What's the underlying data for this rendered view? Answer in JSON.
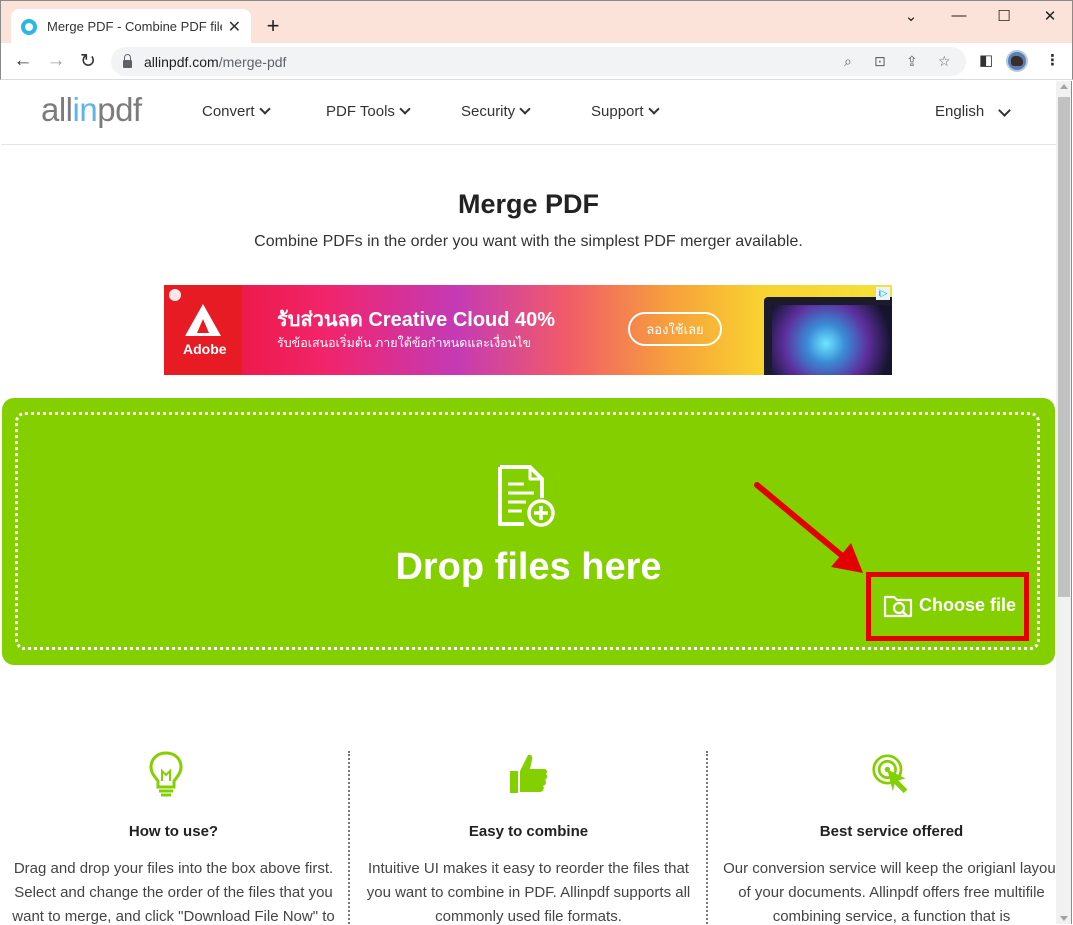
{
  "browser": {
    "tab_title": "Merge PDF - Combine PDF files",
    "tab_close": "✕",
    "new_tab": "+",
    "url_host": "allinpdf.com",
    "url_path": "/merge-pdf"
  },
  "site": {
    "logo_prefix": "all",
    "logo_in": "in",
    "logo_suffix": "pdf",
    "nav": [
      {
        "label": "Convert"
      },
      {
        "label": "PDF Tools"
      },
      {
        "label": "Security"
      },
      {
        "label": "Support"
      }
    ],
    "language": "English"
  },
  "hero": {
    "title": "Merge PDF",
    "subtitle": "Combine PDFs in the order you want with the simplest PDF merger available."
  },
  "ad": {
    "brand": "Adobe",
    "headline": "รับส่วนลด Creative Cloud 40%",
    "subline": "รับข้อเสนอเริ่มต้น ภายใต้ข้อกำหนดและเงื่อนไข",
    "cta": "ลองใช้เลย",
    "info_icon": "i▷"
  },
  "dropzone": {
    "text": "Drop files here",
    "choose_label": "Choose file"
  },
  "features": [
    {
      "icon": "lightbulb-icon",
      "title": "How to use?",
      "text": "Drag and drop your files into the box above first. Select and change the order of the files that you want to merge, and click \"Download File Now\" to"
    },
    {
      "icon": "thumbs-up-icon",
      "title": "Easy to combine",
      "text": "Intuitive UI makes it easy to reorder the files that you want to combine in PDF. Allinpdf supports all commonly used file formats."
    },
    {
      "icon": "target-click-icon",
      "title": "Best service offered",
      "text": "Our conversion service will keep the origianl layout of your documents. Allinpdf offers free multifile combining service, a function that is"
    }
  ],
  "colors": {
    "accent_green": "#84cf00",
    "highlight_red": "#e50000",
    "logo_blue": "#5bb5e6"
  }
}
